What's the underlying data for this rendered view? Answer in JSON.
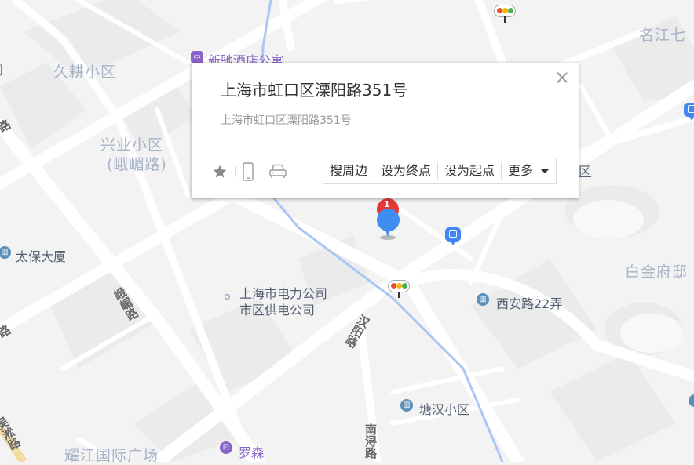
{
  "popup": {
    "title": "上海市虹口区溧阳路351号",
    "address": "上海市虹口区溧阳路351号",
    "icons": [
      "star-icon",
      "phone-icon",
      "car-icon"
    ],
    "buttons": {
      "search_nearby": "搜周边",
      "set_destination": "设为终点",
      "set_origin": "设为起点",
      "more": "更多"
    }
  },
  "marker": {
    "number": "1",
    "color": "#e53935",
    "location_color": "#3d8ef0"
  },
  "labels": {
    "areas": {
      "jiugeng": "久耕小区",
      "xingye": "兴业小区",
      "xingye_sub": "(峨嵋路)",
      "mingjiang": "名江七",
      "baijin": "白金府邸",
      "yaojiang": "耀江国际广场"
    },
    "pois": {
      "hotel": "新驰酒店公寓",
      "taibao": "太保大厦",
      "power1": "上海市电力公司",
      "power2": "市区供电公司",
      "xian": "西安路22弄",
      "tanghan": "塘汉小区",
      "luosen": "罗森"
    },
    "roads": {
      "emei": "峨嵋路",
      "hanyang": "汉阳路",
      "nanxun": "南浔路",
      "lu_left": "路",
      "wusong": "吴淞路",
      "qu_partial": "区"
    }
  },
  "colors": {
    "poi_blue": "#5b8fb9",
    "poi_purple": "#8a63c8",
    "bus": "#4285f4",
    "river": "#a9c6f5"
  }
}
